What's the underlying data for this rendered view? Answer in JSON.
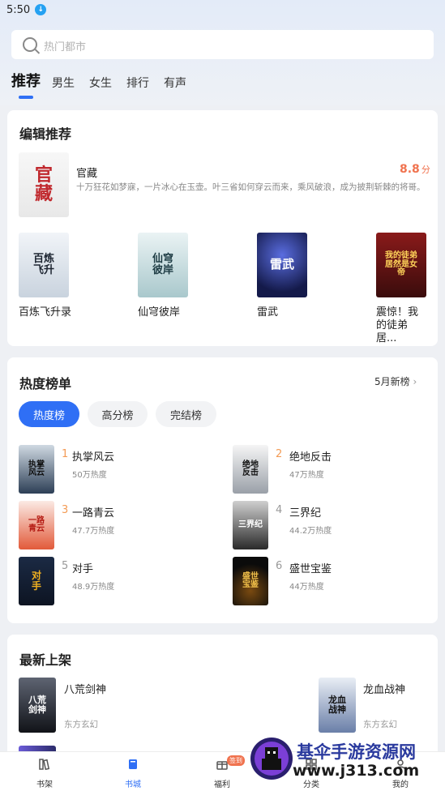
{
  "status_bar": {
    "time": "5:50"
  },
  "search": {
    "placeholder": "热门都市"
  },
  "tabs": [
    {
      "label": "推荐",
      "active": true
    },
    {
      "label": "男生"
    },
    {
      "label": "女生"
    },
    {
      "label": "排行"
    },
    {
      "label": "有声"
    }
  ],
  "editor_picks": {
    "title": "编辑推荐",
    "featured": {
      "title": "官藏",
      "cover_text": "官藏",
      "score": "8.8",
      "score_unit": "分",
      "description": "十万狂花如梦寐，一片冰心在玉壶。叶三省如何穿云而来，乘风破浪，成为披荆斩棘的将哥。"
    },
    "books": [
      {
        "title": "百炼飞升录",
        "cover_text": "百炼飞升"
      },
      {
        "title": "仙穹彼岸",
        "cover_text": "仙穹彼岸"
      },
      {
        "title": "雷武",
        "cover_text": "雷武"
      },
      {
        "title": "震惊！我的徒弟居...",
        "cover_text": "我的徒弟居然是女帝"
      }
    ]
  },
  "hot_list": {
    "title": "热度榜单",
    "month_link": "5月新榜",
    "pills": [
      "热度榜",
      "高分榜",
      "完结榜"
    ],
    "items": [
      {
        "rank": "1",
        "name": "执掌风云",
        "heat": "50万热度",
        "cover_text": "执掌风云"
      },
      {
        "rank": "2",
        "name": "绝地反击",
        "heat": "47万热度",
        "cover_text": "绝地反击"
      },
      {
        "rank": "3",
        "name": "一路青云",
        "heat": "47.7万热度",
        "cover_text": "一路青云"
      },
      {
        "rank": "4",
        "name": "三界纪",
        "heat": "44.2万热度",
        "cover_text": "三界纪"
      },
      {
        "rank": "5",
        "name": "对手",
        "heat": "48.9万热度",
        "cover_text": "对手"
      },
      {
        "rank": "6",
        "name": "盛世宝鉴",
        "heat": "44万热度",
        "cover_text": "盛世宝鉴"
      }
    ]
  },
  "new_arrivals": {
    "title": "最新上架",
    "items": [
      {
        "name": "八荒剑神",
        "category": "东方玄幻",
        "cover_text": "八荒剑神"
      },
      {
        "name": "龙血战神",
        "category": "东方玄幻",
        "cover_text": "龙血战神"
      }
    ]
  },
  "bottom_nav": [
    {
      "label": "书架",
      "icon": "bookshelf-icon"
    },
    {
      "label": "书城",
      "icon": "book-icon",
      "active": true
    },
    {
      "label": "福利",
      "icon": "gift-icon",
      "badge": "签到"
    },
    {
      "label": "分类",
      "icon": "category-icon"
    },
    {
      "label": "我的",
      "icon": "profile-icon"
    }
  ],
  "watermark": {
    "title": "基伞手游资源网",
    "url": "www.j313.com"
  },
  "colors": {
    "accent": "#2f6ff5",
    "score": "#f0734f",
    "rank_top": "#f39b55"
  }
}
